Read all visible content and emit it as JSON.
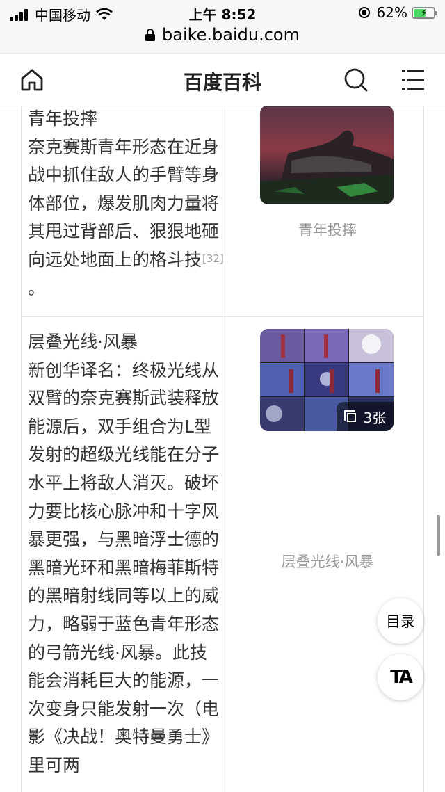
{
  "status_bar": {
    "carrier": "中国移动",
    "time": "上午 8:52",
    "battery_percent": "62%",
    "battery_level": 0.62
  },
  "url_bar": {
    "url": "baike.baidu.com"
  },
  "nav": {
    "title": "百度百科"
  },
  "rows": [
    {
      "skill_name": "青年投摔",
      "description": "奈克赛斯青年形态在近身战中抓住敌人的手臂等身体部位，爆发肌肉力量将其甩过背部后、狠狠地砸向远处地面上的格斗技",
      "citation": "[32]",
      "ending": " 。",
      "image_caption": "青年投摔"
    },
    {
      "skill_name": "层叠光线·风暴",
      "description": "新创华译名：终极光线从双臂的奈克赛斯武装释放能源后，双手组合为L型发射的超级光线能在分子水平上将敌人消灭。破坏力要比核心脉冲和十字风暴更强，与黑暗浮士德的黑暗光环和黑暗梅菲斯特的黑暗射线同等以上的威力，略弱于蓝色青年形态的弓箭光线·风暴。此技能会消耗巨大的能源，一次变身只能发射一次（电影《决战！奥特曼勇士》里可两",
      "image_caption": "层叠光线·风暴",
      "image_count": "3张"
    }
  ],
  "floating": {
    "toc_label": "目录",
    "font_label": "TA"
  },
  "colors": {
    "accent_battery": "#4cd964",
    "caption_gray": "#999999",
    "border": "#e6e6e6"
  }
}
